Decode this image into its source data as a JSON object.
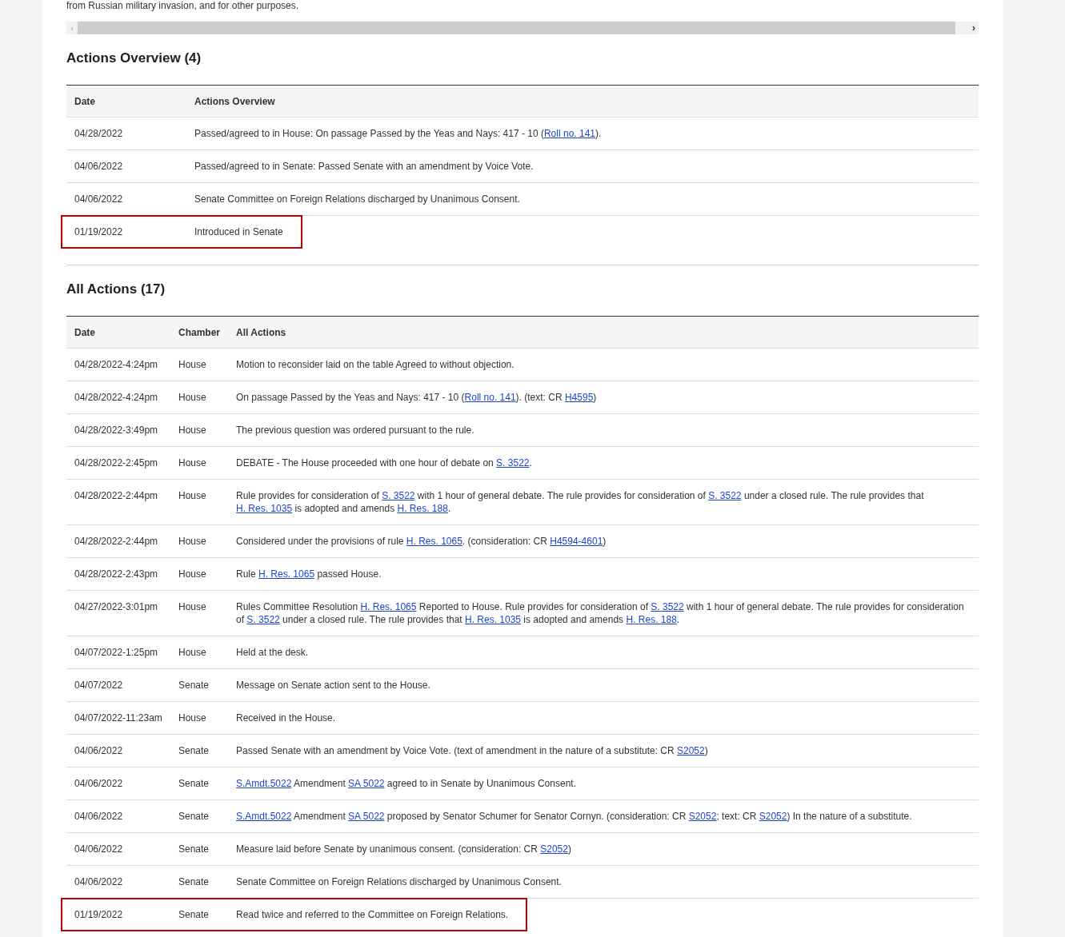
{
  "intro_text": "from Russian military invasion, and for other purposes.",
  "scrollbar": {
    "left_arrow": "‹",
    "right_arrow": "›"
  },
  "overview": {
    "title": "Actions Overview (4)",
    "columns": [
      "Date",
      "Actions Overview"
    ],
    "rows": [
      {
        "date": "04/28/2022",
        "highlighted": false,
        "parts": [
          {
            "text": "Passed/agreed to in House: On passage Passed by the Yeas and Nays: 417 - 10 ("
          },
          {
            "link": "Roll no. 141"
          },
          {
            "text": ")."
          }
        ]
      },
      {
        "date": "04/06/2022",
        "highlighted": false,
        "parts": [
          {
            "text": "Passed/agreed to in Senate: Passed Senate with an amendment by Voice Vote."
          }
        ]
      },
      {
        "date": "04/06/2022",
        "highlighted": false,
        "parts": [
          {
            "text": "Senate Committee on Foreign Relations discharged by Unanimous Consent."
          }
        ]
      },
      {
        "date": "01/19/2022",
        "highlighted": true,
        "parts": [
          {
            "text": "Introduced in Senate"
          }
        ]
      }
    ]
  },
  "all_actions": {
    "title": "All Actions (17)",
    "columns": [
      "Date",
      "Chamber",
      "All Actions"
    ],
    "rows": [
      {
        "date": "04/28/2022-4:24pm",
        "chamber": "House",
        "highlighted": false,
        "parts": [
          {
            "text": "Motion to reconsider laid on the table Agreed to without objection."
          }
        ]
      },
      {
        "date": "04/28/2022-4:24pm",
        "chamber": "House",
        "highlighted": false,
        "parts": [
          {
            "text": "On passage Passed by the Yeas and Nays: 417 - 10 ("
          },
          {
            "link": "Roll no. 141"
          },
          {
            "text": "). (text: CR "
          },
          {
            "link": "H4595"
          },
          {
            "text": ")"
          }
        ]
      },
      {
        "date": "04/28/2022-3:49pm",
        "chamber": "House",
        "highlighted": false,
        "parts": [
          {
            "text": "The previous question was ordered pursuant to the rule."
          }
        ]
      },
      {
        "date": "04/28/2022-2:45pm",
        "chamber": "House",
        "highlighted": false,
        "parts": [
          {
            "text": "DEBATE - The House proceeded with one hour of debate on "
          },
          {
            "link": "S. 3522"
          },
          {
            "text": "."
          }
        ]
      },
      {
        "date": "04/28/2022-2:44pm",
        "chamber": "House",
        "highlighted": false,
        "parts": [
          {
            "text": "Rule provides for consideration of "
          },
          {
            "link": "S. 3522"
          },
          {
            "text": " with 1 hour of general debate. The rule provides for consideration of "
          },
          {
            "link": "S. 3522"
          },
          {
            "text": " under a closed rule. The rule provides that "
          },
          {
            "link": "H. Res. 1035"
          },
          {
            "text": " is adopted and amends "
          },
          {
            "link": "H. Res. 188"
          },
          {
            "text": "."
          }
        ]
      },
      {
        "date": "04/28/2022-2:44pm",
        "chamber": "House",
        "highlighted": false,
        "parts": [
          {
            "text": "Considered under the provisions of rule "
          },
          {
            "link": "H. Res. 1065"
          },
          {
            "text": ". (consideration: CR "
          },
          {
            "link": "H4594-4601"
          },
          {
            "text": ")"
          }
        ]
      },
      {
        "date": "04/28/2022-2:43pm",
        "chamber": "House",
        "highlighted": false,
        "parts": [
          {
            "text": "Rule "
          },
          {
            "link": "H. Res. 1065"
          },
          {
            "text": " passed House."
          }
        ]
      },
      {
        "date": "04/27/2022-3:01pm",
        "chamber": "House",
        "highlighted": false,
        "parts": [
          {
            "text": "Rules Committee Resolution "
          },
          {
            "link": "H. Res. 1065"
          },
          {
            "text": " Reported to House. Rule provides for consideration of "
          },
          {
            "link": "S. 3522"
          },
          {
            "text": " with 1 hour of general debate. The rule provides for consideration of "
          },
          {
            "link": "S. 3522"
          },
          {
            "text": " under a closed rule. The rule provides that "
          },
          {
            "link": "H. Res. 1035"
          },
          {
            "text": " is adopted and amends "
          },
          {
            "link": "H. Res. 188"
          },
          {
            "text": "."
          }
        ]
      },
      {
        "date": "04/07/2022-1:25pm",
        "chamber": "House",
        "highlighted": false,
        "parts": [
          {
            "text": "Held at the desk."
          }
        ]
      },
      {
        "date": "04/07/2022",
        "chamber": "Senate",
        "highlighted": false,
        "parts": [
          {
            "text": "Message on Senate action sent to the House."
          }
        ]
      },
      {
        "date": "04/07/2022-11:23am",
        "chamber": "House",
        "highlighted": false,
        "parts": [
          {
            "text": "Received in the House."
          }
        ]
      },
      {
        "date": "04/06/2022",
        "chamber": "Senate",
        "highlighted": false,
        "parts": [
          {
            "text": "Passed Senate with an amendment by Voice Vote. (text of amendment in the nature of a substitute: CR "
          },
          {
            "link": "S2052"
          },
          {
            "text": ")"
          }
        ]
      },
      {
        "date": "04/06/2022",
        "chamber": "Senate",
        "highlighted": false,
        "parts": [
          {
            "link": "S.Amdt.5022"
          },
          {
            "text": " Amendment "
          },
          {
            "link": "SA 5022"
          },
          {
            "text": " agreed to in Senate by Unanimous Consent."
          }
        ]
      },
      {
        "date": "04/06/2022",
        "chamber": "Senate",
        "highlighted": false,
        "parts": [
          {
            "link": "S.Amdt.5022"
          },
          {
            "text": " Amendment "
          },
          {
            "link": "SA 5022"
          },
          {
            "text": " proposed by Senator Schumer for Senator Cornyn. (consideration: CR "
          },
          {
            "link": "S2052"
          },
          {
            "text": "; text: CR "
          },
          {
            "link": "S2052"
          },
          {
            "text": ") In the nature of a substitute."
          }
        ]
      },
      {
        "date": "04/06/2022",
        "chamber": "Senate",
        "highlighted": false,
        "parts": [
          {
            "text": "Measure laid before Senate by unanimous consent. (consideration: CR "
          },
          {
            "link": "S2052"
          },
          {
            "text": ")"
          }
        ]
      },
      {
        "date": "04/06/2022",
        "chamber": "Senate",
        "highlighted": false,
        "parts": [
          {
            "text": "Senate Committee on Foreign Relations discharged by Unanimous Consent."
          }
        ]
      },
      {
        "date": "01/19/2022",
        "chamber": "Senate",
        "highlighted": true,
        "parts": [
          {
            "text": "Read twice and referred to the Committee on Foreign Relations."
          }
        ]
      }
    ]
  }
}
